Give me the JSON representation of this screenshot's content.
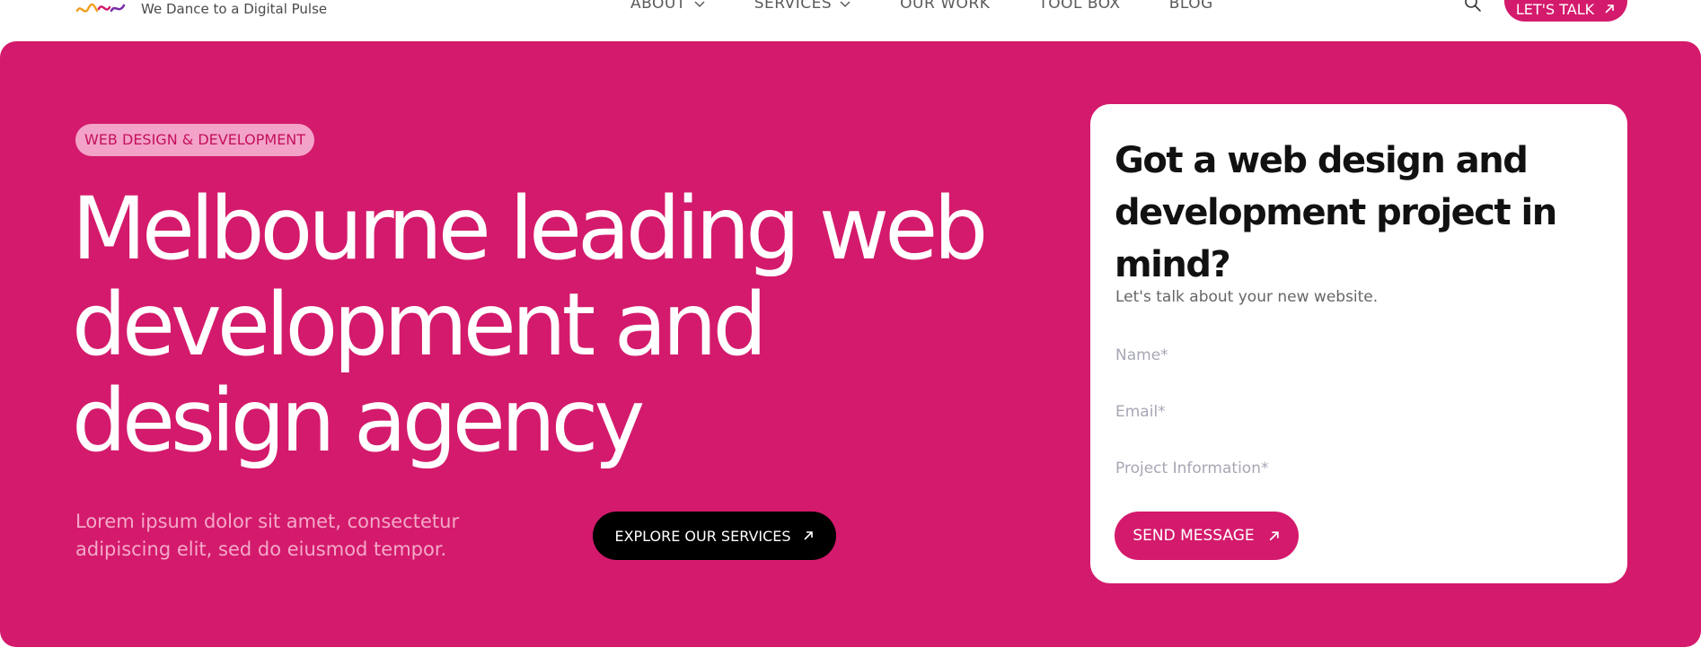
{
  "header": {
    "logo_icon": "brand-squiggle-logo",
    "tagline": "We Dance to a Digital Pulse",
    "nav": [
      {
        "label": "ABOUT",
        "has_dropdown": true
      },
      {
        "label": "SERVICES",
        "has_dropdown": true
      },
      {
        "label": "OUR WORK",
        "has_dropdown": false
      },
      {
        "label": "TOOL BOX",
        "has_dropdown": false
      },
      {
        "label": "BLOG",
        "has_dropdown": false
      }
    ],
    "search_icon": "search-icon",
    "cta_label": "LET'S TALK"
  },
  "hero": {
    "badge": "WEB DESIGN & DEVELOPMENT",
    "headline": "Melbourne leading web development and design agency",
    "lead": "Lorem ipsum dolor sit amet, consectetur adipiscing elit, sed do eiusmod tempor.",
    "explore_label": "EXPLORE OUR SERVICES"
  },
  "form": {
    "title": "Got a web design and development project in mind?",
    "subtitle": "Let's talk about your new website.",
    "name_placeholder": "Name*",
    "email_placeholder": "Email*",
    "project_placeholder": "Project Information*",
    "send_label": "SEND MESSAGE"
  },
  "colors": {
    "brand_pink": "#d41a6c",
    "badge_bg": "#f3a3c7",
    "button_dark": "#000000",
    "card_bg": "#ffffff"
  }
}
